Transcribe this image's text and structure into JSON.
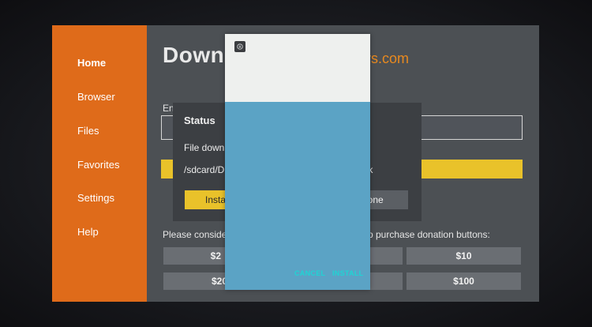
{
  "sidebar": {
    "items": [
      {
        "label": "Home",
        "active": true
      },
      {
        "label": "Browser",
        "active": false
      },
      {
        "label": "Files",
        "active": false
      },
      {
        "label": "Favorites",
        "active": false
      },
      {
        "label": "Settings",
        "active": false
      },
      {
        "label": "Help",
        "active": false
      }
    ]
  },
  "main": {
    "brand_visible": "Down",
    "brand_suffix": "rs.com",
    "enter_label": "En",
    "donate_text_left": "Please conside",
    "donate_text_right": "p purchase donation buttons:",
    "donation_buttons": [
      "$2",
      "$10",
      "$20",
      "$100"
    ]
  },
  "status_dialog": {
    "title": "Status",
    "line1": "File downl",
    "line2": "/sdcard/D",
    "line2_end": "apk",
    "install_label": "Insta",
    "done_label": "Done"
  },
  "installer": {
    "cancel_label": "CANCEL",
    "install_label": "INSTALL"
  },
  "colors": {
    "sidebar": "#df6b1a",
    "accent_yellow": "#e9c22a",
    "installer_body": "#5ba3c5",
    "installer_button_text": "#1fd4d4"
  }
}
